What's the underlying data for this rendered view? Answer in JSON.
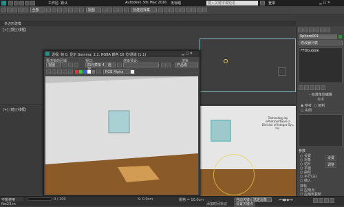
{
  "titlebar": {
    "workspace_label": "工作区: 默认",
    "title": "Autodesk 3ds Max 2016",
    "doc": "无标题",
    "search_placeholder": "键入关键字或短语",
    "sign_in": "登录"
  },
  "ribbon": {
    "mode_select": "全部",
    "view_select": "视图",
    "selection_set": "创建选择集"
  },
  "scene_tab": "多边形建模",
  "viewports": {
    "top_label": "[+] [顶] [线框]",
    "left_label": "[+] [前] [线框]",
    "right_text": "Technology by ePhotoSoftware a Division of Integra-Sys, Inc."
  },
  "render_window": {
    "title": "透视, 帧 0, 显示 Gamma: 2.2, RGBA 颜色 16 位/通道 (1:1)",
    "area_label": "要渲染的区域:",
    "area_value": "视图",
    "viewport_label": "视口:",
    "viewport_value": "四元菜单 4 - 透视",
    "preset_label": "渲染预设:",
    "preset_value": "",
    "render_label": "渲染",
    "render_value": "产品级",
    "channel_value": "RGB Alpha"
  },
  "command_panel": {
    "object_name": "Sphere001",
    "modifier_list": "修改器列表",
    "stack_item": "FFDbubble",
    "standard": "标准",
    "rollout_title": "- 标准单位编辑",
    "radio_a": "参考",
    "radio_b": "复制",
    "radio_c": "实例",
    "params_title": "参数",
    "rows": [
      "设置",
      "对象",
      "切片",
      "平面",
      "曲线",
      "平行(主)",
      "插入"
    ],
    "btn1": "设置",
    "btn2": "调整",
    "section2": "目标",
    "check1": "应用点",
    "check2": "应用到复制",
    "check3": "应用到所有对象"
  },
  "status": {
    "left1": "不能使用 fbx23.m",
    "coords": "X: 0.0cm",
    "grid": "栅格 = 10.0cm",
    "add_time_tag": "添加时间标记",
    "auto_key": "自动关键点",
    "set_key": "设置关键点",
    "select_obj": "选定对象",
    "frame": "0 / 100"
  },
  "colors": {
    "render_bg": "#c8c8c8",
    "floor": "#8a5a28",
    "wall": "#dcdcdc",
    "frame": "#7fbfbf",
    "accent": "#4a90d9"
  }
}
